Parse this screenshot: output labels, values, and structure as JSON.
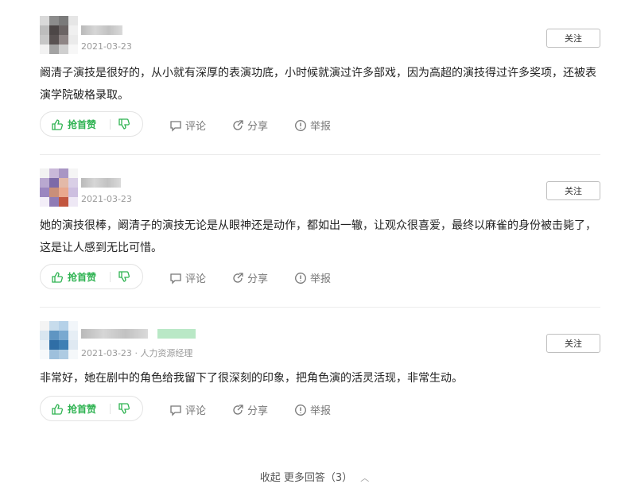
{
  "answers": [
    {
      "date": "2021-03-23",
      "job_title": "",
      "follow_label": "关注",
      "content": "阚清子演技是很好的，从小就有深厚的表演功底，小时候就演过许多部戏，因为高超的演技得过许多奖项，还被表演学院破格录取。",
      "vote_up_label": "抢首赞",
      "comment_label": "评论",
      "share_label": "分享",
      "report_label": "举报",
      "avatar_colors": [
        "#d9d9d9",
        "#8c8c8c",
        "#7a7a7a",
        "#e6e6e6",
        "#bdbdbd",
        "#4d4747",
        "#6b6464",
        "#f0f0f0",
        "#c7c7c7",
        "#595252",
        "#8e8585",
        "#ebebeb",
        "#f2f2f2",
        "#a3a3a3",
        "#cfcfcf",
        "#f7f7f7"
      ]
    },
    {
      "date": "2021-03-23",
      "job_title": "",
      "follow_label": "关注",
      "content": "她的演技很棒，阚清子的演技无论是从眼神还是动作，都如出一辙，让观众很喜爱，最终以麻雀的身份被击毙了，这是让人感到无比可惜。",
      "vote_up_label": "抢首赞",
      "comment_label": "评论",
      "share_label": "分享",
      "report_label": "举报",
      "avatar_colors": [
        "#f2f2f2",
        "#c9b8d9",
        "#a996c4",
        "#f5f5f5",
        "#b9a8d0",
        "#7d6aa8",
        "#e3b9a8",
        "#d9cfe6",
        "#9b86c0",
        "#c98f7a",
        "#e9a88e",
        "#cdbfe0",
        "#f3eef8",
        "#8f7bb5",
        "#c2563f",
        "#eee8f5"
      ]
    },
    {
      "date": "2021-03-23",
      "job_title": "人力资源经理",
      "follow_label": "关注",
      "content": "非常好，她在剧中的角色给我留下了很深刻的印象，把角色演的活灵活现，非常生动。",
      "vote_up_label": "抢首赞",
      "comment_label": "评论",
      "share_label": "分享",
      "report_label": "举报",
      "avatar_colors": [
        "#f4f4f4",
        "#c7dcec",
        "#b5d1e8",
        "#f2f6fa",
        "#d9e6f0",
        "#5f95c2",
        "#7aa9d0",
        "#e6eef5",
        "#e9f0f6",
        "#2f6ea6",
        "#3e7fb4",
        "#dfe9f2",
        "#f7f9fb",
        "#9ec0dc",
        "#aecbe2",
        "#f5f8fa"
      ]
    }
  ],
  "footer": {
    "label": "收起 更多回答（3）",
    "chevron": "chevron-up-icon"
  },
  "colors": {
    "accent_green": "#2fb352",
    "muted_text": "#777777",
    "divider": "#ececec"
  }
}
